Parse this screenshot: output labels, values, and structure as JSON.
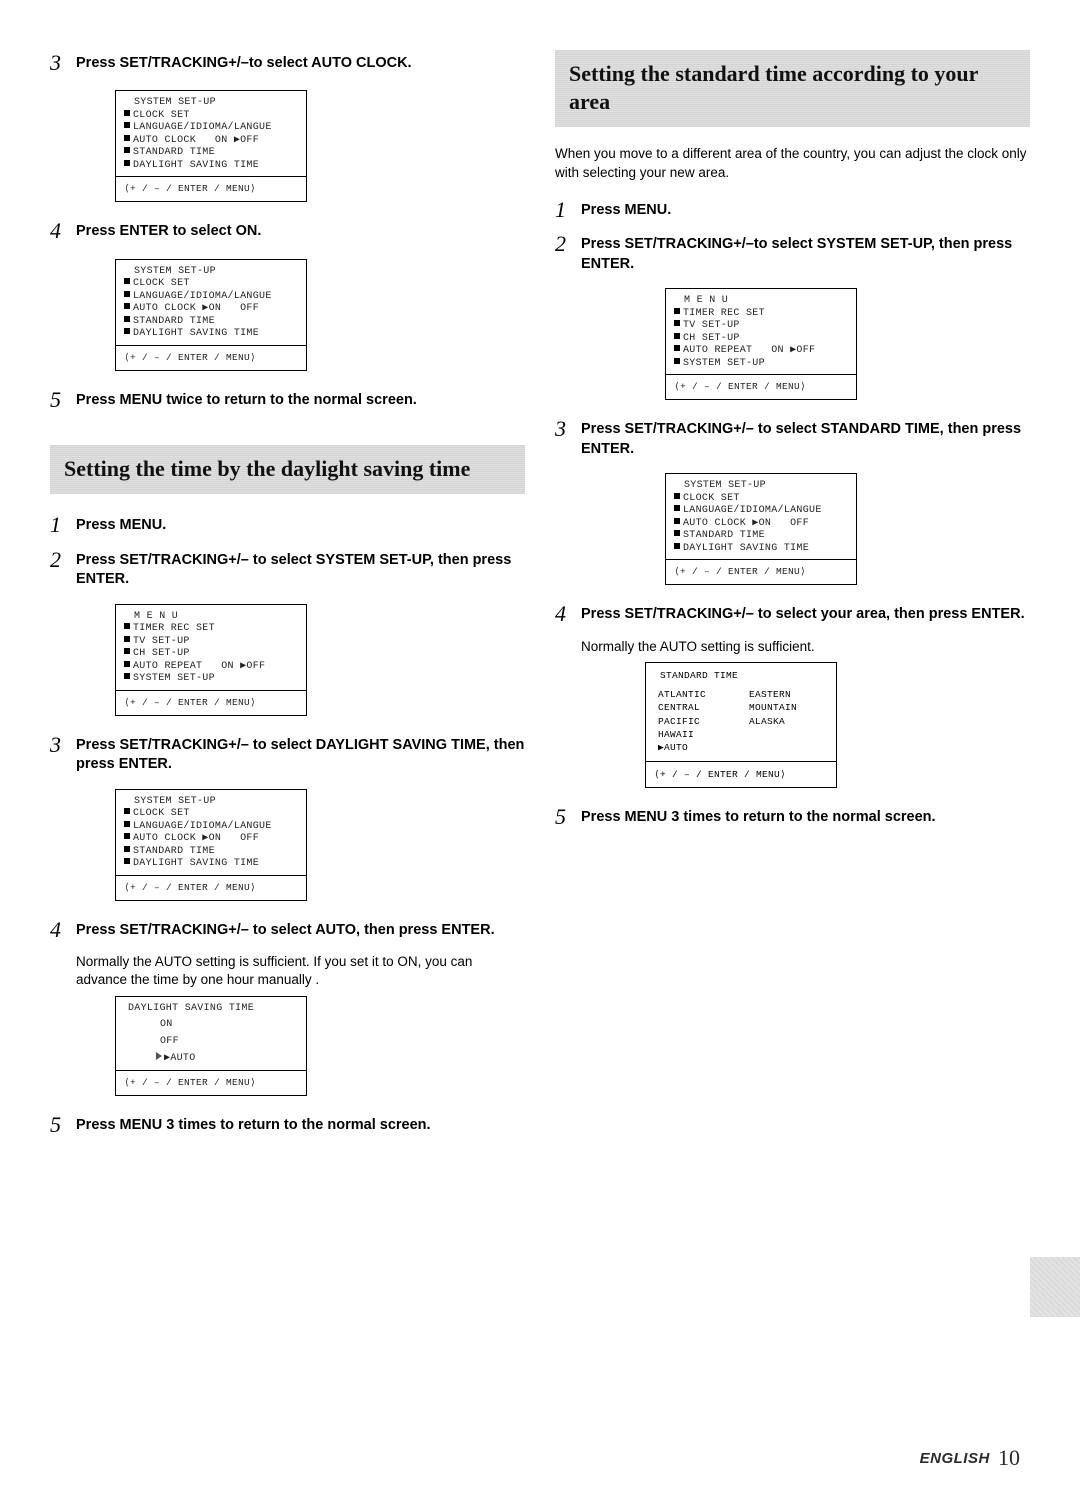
{
  "footer": {
    "lang": "ENGLISH",
    "page": "10"
  },
  "left": {
    "step3": {
      "num": "3",
      "text": "Press SET/TRACKING+/–to select AUTO CLOCK.",
      "screen": {
        "l1": "SYSTEM SET-UP",
        "l2": "CLOCK SET",
        "l3": "LANGUAGE/IDIOMA/LANGUE",
        "l4": "AUTO CLOCK   ON ▶OFF",
        "l5": "STANDARD TIME",
        "l6": "DAYLIGHT SAVING TIME",
        "nav": "⟨+ / – / ENTER / MENU⟩"
      }
    },
    "step4": {
      "num": "4",
      "text": "Press ENTER to select ON.",
      "screen": {
        "l1": "SYSTEM SET-UP",
        "l2": "CLOCK SET",
        "l3": "LANGUAGE/IDIOMA/LANGUE",
        "l4": "AUTO CLOCK ▶ON   OFF",
        "l5": "STANDARD TIME",
        "l6": "DAYLIGHT SAVING TIME",
        "nav": "⟨+ / – / ENTER / MENU⟩"
      }
    },
    "step5": {
      "num": "5",
      "text": "Press MENU twice to return to the normal screen."
    },
    "sectionA": {
      "title": "Setting the time by the daylight saving time"
    },
    "a1": {
      "num": "1",
      "text": "Press MENU."
    },
    "a2": {
      "num": "2",
      "text": "Press SET/TRACKING+/– to select SYSTEM SET-UP, then press ENTER.",
      "screen": {
        "l1": "M E N U",
        "l2": "TIMER REC SET",
        "l3": "TV SET-UP",
        "l4": "CH SET-UP",
        "l5": "AUTO REPEAT   ON ▶OFF",
        "l6": "SYSTEM SET-UP",
        "nav": "⟨+ / – / ENTER / MENU⟩"
      }
    },
    "a3": {
      "num": "3",
      "text": "Press SET/TRACKING+/– to select DAYLIGHT SAVING TIME, then press ENTER.",
      "screen": {
        "l1": "SYSTEM SET-UP",
        "l2": "CLOCK SET",
        "l3": "LANGUAGE/IDIOMA/LANGUE",
        "l4": "AUTO CLOCK ▶ON   OFF",
        "l5": "STANDARD TIME",
        "l6": "DAYLIGHT SAVING TIME",
        "nav": "⟨+ / – / ENTER / MENU⟩"
      }
    },
    "a4": {
      "num": "4",
      "text": "Press SET/TRACKING+/– to select AUTO, then press ENTER.",
      "sub": "Normally the AUTO setting is sufficient. If you set it to ON, you can advance the time by one hour manually .",
      "screen": {
        "l1": "DAYLIGHT SAVING TIME",
        "l2": "ON",
        "l3": "OFF",
        "l4": "▶AUTO",
        "nav": "⟨+ / – / ENTER / MENU⟩"
      }
    },
    "a5": {
      "num": "5",
      "text": "Press MENU 3 times to return to the normal screen."
    }
  },
  "right": {
    "sectionB": {
      "title": "Setting the standard time according to your area"
    },
    "intro": "When you move to a different area of the country, you can adjust the clock only with selecting your new area.",
    "b1": {
      "num": "1",
      "text": "Press MENU."
    },
    "b2": {
      "num": "2",
      "text": "Press SET/TRACKING+/–to select SYSTEM SET-UP, then press ENTER.",
      "screen": {
        "l1": "M E N U",
        "l2": "TIMER REC SET",
        "l3": "TV SET-UP",
        "l4": "CH SET-UP",
        "l5": "AUTO REPEAT   ON ▶OFF",
        "l6": "SYSTEM SET-UP",
        "nav": "⟨+ / – / ENTER / MENU⟩"
      }
    },
    "b3": {
      "num": "3",
      "text": "Press SET/TRACKING+/– to select STANDARD TIME, then press ENTER.",
      "screen": {
        "l1": "SYSTEM SET-UP",
        "l2": "CLOCK SET",
        "l3": "LANGUAGE/IDIOMA/LANGUE",
        "l4": "AUTO CLOCK ▶ON   OFF",
        "l5": "STANDARD TIME",
        "l6": "DAYLIGHT SAVING TIME",
        "nav": "⟨+ / – / ENTER / MENU⟩"
      }
    },
    "b4": {
      "num": "4",
      "text": "Press SET/TRACKING+/– to select your area, then press ENTER.",
      "sub": "Normally the AUTO setting is sufficient.",
      "screen": {
        "title": "STANDARD TIME",
        "c1a": "ATLANTIC",
        "c1b": "CENTRAL",
        "c1c": "PACIFIC",
        "c1d": "HAWAII",
        "c1e": "▶AUTO",
        "c2a": "EASTERN",
        "c2b": "MOUNTAIN",
        "c2c": "ALASKA",
        "nav": "⟨+ / – / ENTER / MENU⟩"
      }
    },
    "b5": {
      "num": "5",
      "text": "Press MENU 3 times to return to the normal screen."
    }
  }
}
